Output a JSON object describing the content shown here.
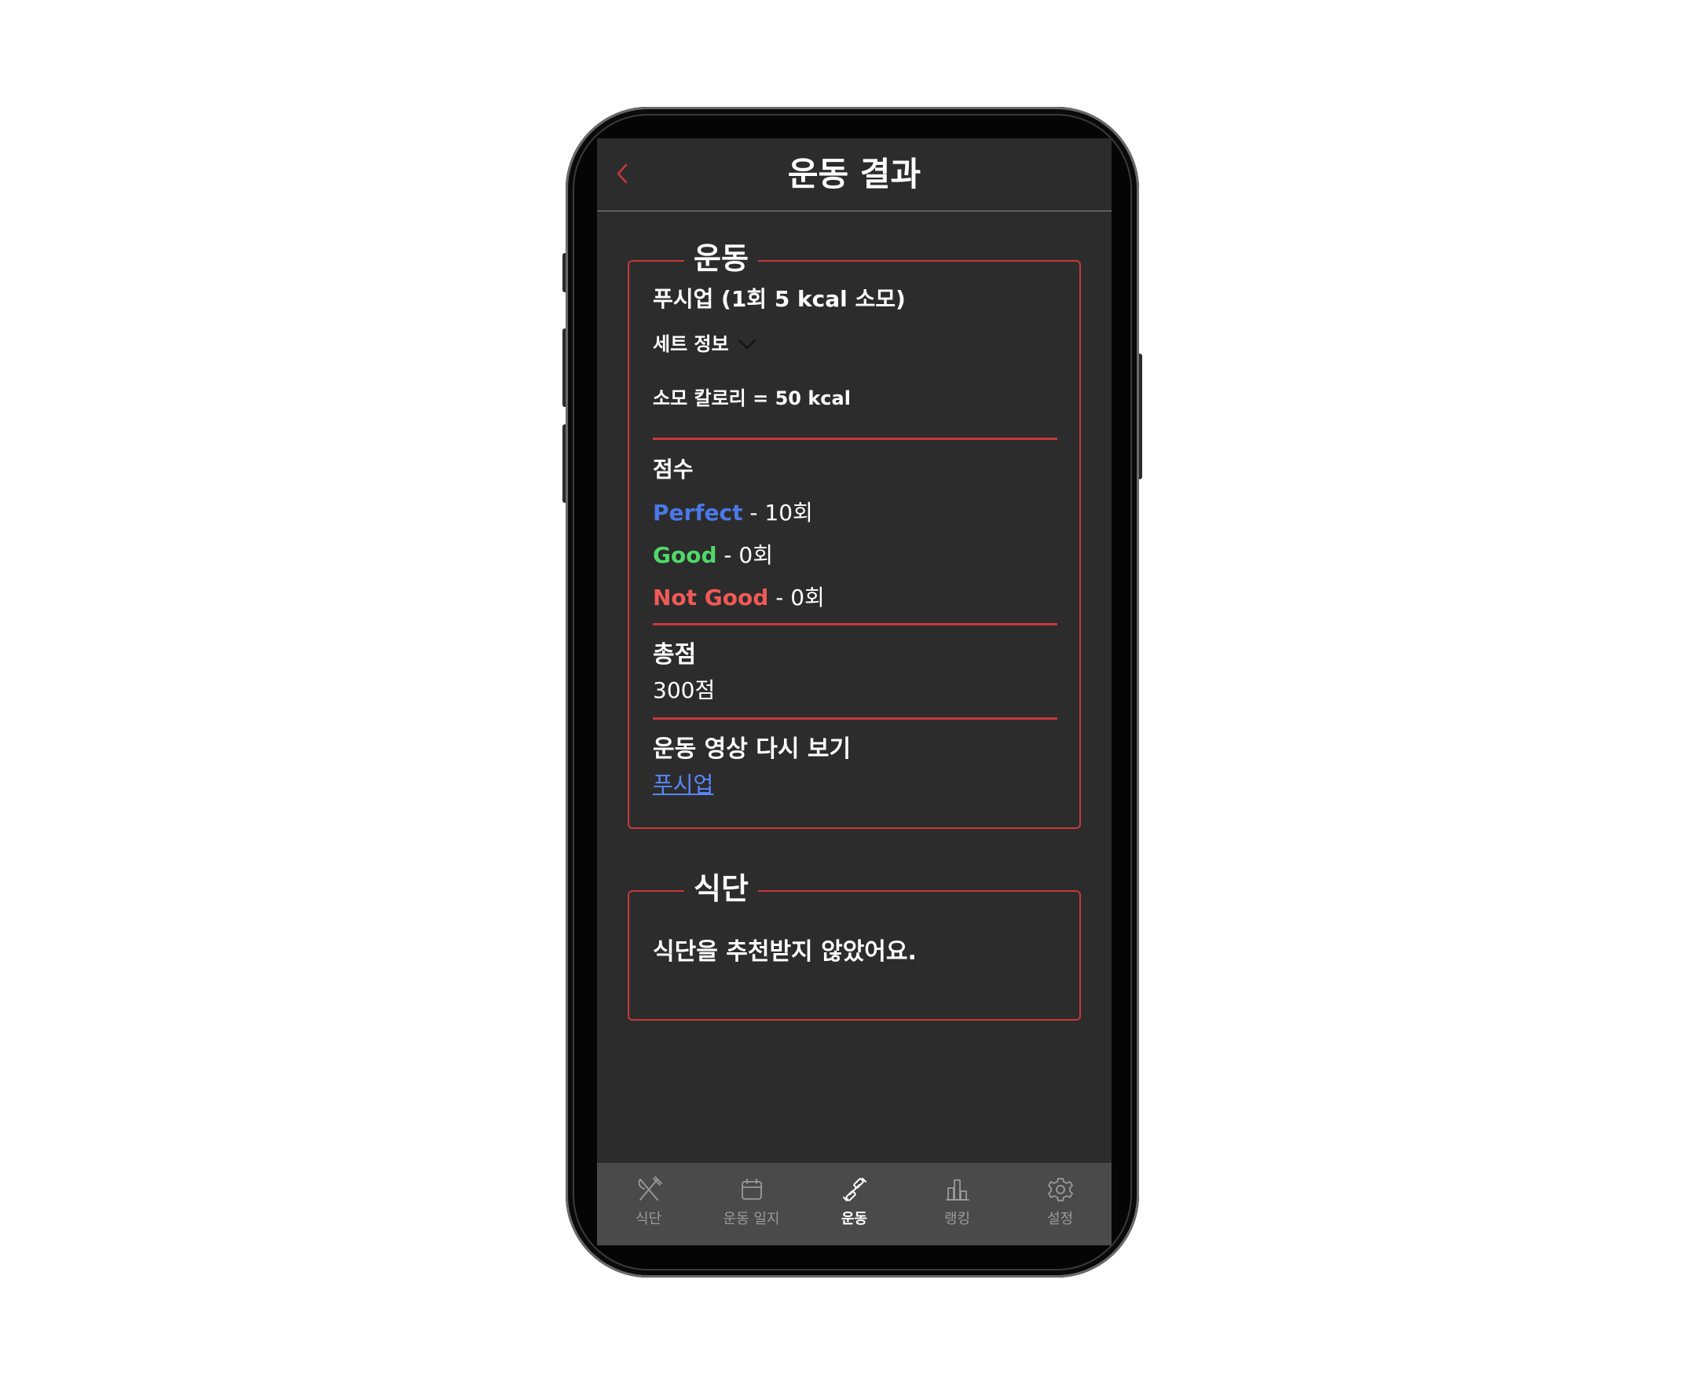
{
  "header": {
    "title": "운동 결과",
    "back_icon": "chevron-left-icon"
  },
  "exercise_card": {
    "title": "운동",
    "exercise_name": "푸시업 (1회 5 kcal 소모)",
    "set_info_label": "세트 정보",
    "calories": "소모 칼로리 = 50 kcal",
    "score_label": "점수",
    "perfect_label": "Perfect",
    "perfect_count": " - 10회",
    "good_label": "Good",
    "good_count": " - 0회",
    "notgood_label": "Not Good",
    "notgood_count": " - 0회",
    "total_label": "총점",
    "total_value": "300점",
    "replay_label": "운동 영상 다시 보기",
    "replay_link": "푸시업"
  },
  "diet_card": {
    "title": "식단",
    "message": "식단을 추천받지 않았어요."
  },
  "tabbar": {
    "items": [
      {
        "label": "식단",
        "icon": "utensils-icon",
        "active": false
      },
      {
        "label": "운동 일지",
        "icon": "calendar-icon",
        "active": false
      },
      {
        "label": "운동",
        "icon": "dumbbell-icon",
        "active": true
      },
      {
        "label": "랭킹",
        "icon": "bar-chart-icon",
        "active": false
      },
      {
        "label": "설정",
        "icon": "gear-icon",
        "active": false
      }
    ]
  },
  "colors": {
    "accent_red": "#c6383c",
    "perfect": "#4a78e6",
    "good": "#52d86a",
    "not_good": "#f05a56",
    "screen_bg": "#2c2c2c",
    "tabbar_bg": "#4a4a4a"
  }
}
